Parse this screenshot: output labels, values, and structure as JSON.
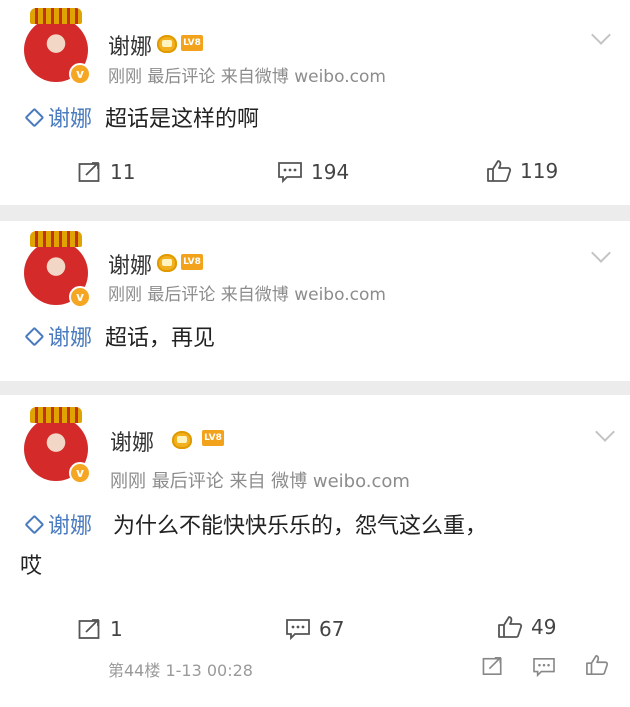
{
  "posts": [
    {
      "author": "谢娜",
      "level": "LV8",
      "meta": "刚刚 最后评论  来自微博 weibo.com",
      "topic": "谢娜",
      "text": "超话是这样的啊",
      "reposts": "11",
      "comments": "194",
      "likes": "119"
    },
    {
      "author": "谢娜",
      "level": "LV8",
      "meta": "刚刚 最后评论  来自微博 weibo.com",
      "topic": "谢娜",
      "text": "超话，再见"
    },
    {
      "author": "谢娜",
      "level": "LV8",
      "meta": "刚刚 最后评论  来自 微博 weibo.com",
      "topic": "谢娜",
      "text": "为什么不能快快乐乐的，怨气这么重，",
      "text2": "哎",
      "reposts": "1",
      "comments": "67",
      "likes": "49",
      "footer": "第44楼 1-13 00:28"
    }
  ],
  "colors": {
    "topic": "#4a7bbf",
    "badge": "#f2a21b",
    "meta": "#8c8c8c"
  },
  "icons": [
    "repost-icon",
    "comment-icon",
    "like-icon",
    "chevron-down-icon",
    "topic-icon",
    "crown-icon"
  ]
}
